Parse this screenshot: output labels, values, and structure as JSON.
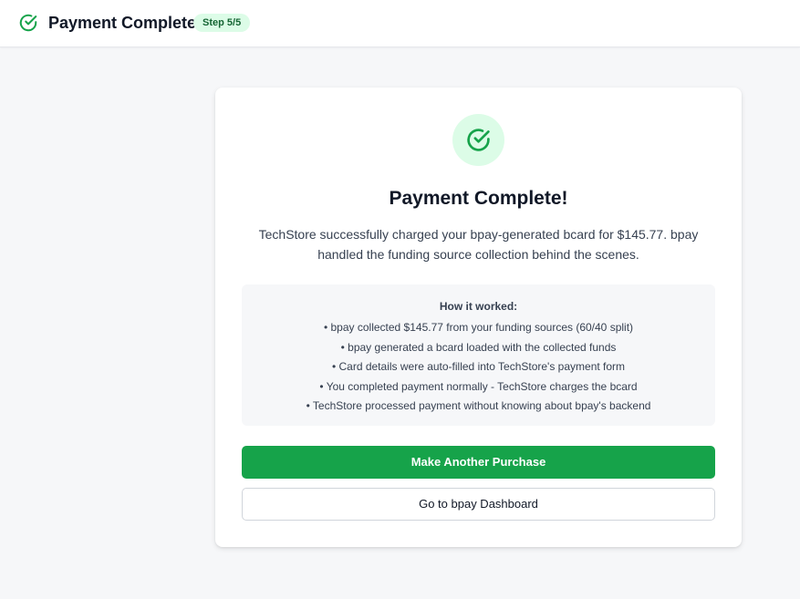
{
  "header": {
    "title": "Payment Complete",
    "step_badge": "Step 5/5",
    "icon": "check-circle-icon"
  },
  "card": {
    "icon": "check-circle-icon",
    "heading": "Payment Complete!",
    "description": "TechStore successfully charged your bpay-generated bcard for $145.77. bpay handled the funding source collection behind the scenes.",
    "how_it_worked": {
      "title": "How it worked:",
      "items": [
        "• bpay collected $145.77 from your funding sources (60/40 split)",
        "• bpay generated a bcard loaded with the collected funds",
        "• Card details were auto-filled into TechStore's payment form",
        "• You completed payment normally - TechStore charges the bcard",
        "• TechStore processed payment without knowing about bpay's backend"
      ]
    },
    "primary_button": "Make Another Purchase",
    "secondary_button": "Go to bpay Dashboard"
  },
  "colors": {
    "accent": "#16a34a",
    "accent_light": "#dcfce7",
    "page_background": "#f6f7f9"
  }
}
